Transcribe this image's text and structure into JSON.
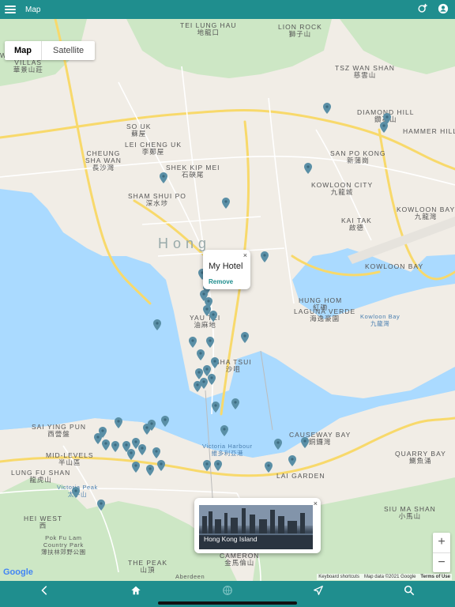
{
  "app": {
    "title": "Map"
  },
  "map_type": {
    "map_label": "Map",
    "satellite_label": "Satellite"
  },
  "popup_hotel": {
    "title": "My Hotel",
    "remove_label": "Remove",
    "close": "×"
  },
  "popup_place": {
    "caption": "Hong Kong Island",
    "close": "×"
  },
  "zoom": {
    "in": "+",
    "out": "−"
  },
  "google_logo": "Google",
  "attribution": {
    "shortcuts": "Keyboard shortcuts",
    "data": "Map data ©2021 Google",
    "terms": "Terms of Use"
  },
  "labels": [
    {
      "id": "tiu-keng",
      "text": "TEI LUNG HAU\n地龍口"
    },
    {
      "id": "lion-rock",
      "text": "LION ROCK\n獅子山"
    },
    {
      "id": "wonderland",
      "text": "WONDERLAND\nVILLAS\n華景山莊"
    },
    {
      "id": "tsz-wan-shan",
      "text": "TSZ WAN SHAN\n慈雲山"
    },
    {
      "id": "diamond-hill",
      "text": "DIAMOND HILL\n鑽石山"
    },
    {
      "id": "su-uk",
      "text": "SO UK\n蘇屋"
    },
    {
      "id": "lei-cheng-uk",
      "text": "LEI CHENG UK\n李鄭屋"
    },
    {
      "id": "hammer-hill",
      "text": "HAMMER HILL"
    },
    {
      "id": "cheung-sha-wan",
      "text": "CHEUNG\nSHA WAN\n長沙灣"
    },
    {
      "id": "shek-kip-mei",
      "text": "SHEK KIP MEI\n石硤尾"
    },
    {
      "id": "san-po-kong",
      "text": "SAN PO KONG\n新蒲崗"
    },
    {
      "id": "sham-shui-po",
      "text": "SHAM SHUI PO\n深水埗"
    },
    {
      "id": "kowloon-city",
      "text": "KOWLOON CITY\n九龍城"
    },
    {
      "id": "kowloon-bay",
      "text": "KOWLOON BAY\n九龍灣"
    },
    {
      "id": "kai-tak",
      "text": "KAI TAK\n啟德"
    },
    {
      "id": "hong",
      "text": "Hong"
    },
    {
      "id": "yau-tei",
      "text": "YAU TEI\n油麻地"
    },
    {
      "id": "hung-hom",
      "text": "HUNG HOM\n紅磡"
    },
    {
      "id": "laguna",
      "text": "LAGUNA VERDE\n海逸豪園"
    },
    {
      "id": "kowloon-bay-water",
      "text": "Kowloon Bay\n九龍灣"
    },
    {
      "id": "tsim-sha-tsui",
      "text": "SHA TSUI\n沙咀"
    },
    {
      "id": "kowloon-bay-2",
      "text": "KOWLOON BAY"
    },
    {
      "id": "sai-ying-pun",
      "text": "SAI YING PUN\n西營盤"
    },
    {
      "id": "victoria-harbour",
      "text": "Victoria Harbour\n維多利亞港"
    },
    {
      "id": "causeway-bay",
      "text": "CAUSEWAY BAY\n銅鑼灣"
    },
    {
      "id": "quarry-bay",
      "text": "QUARRY BAY\n鰂魚涌"
    },
    {
      "id": "mid-levels",
      "text": "MID-LEVELS\n半山區"
    },
    {
      "id": "lung-fu-shan",
      "text": "LUNG FU SHAN\n龍虎山"
    },
    {
      "id": "victoria-peak",
      "text": "Victoria Peak\n太平山"
    },
    {
      "id": "hei-west",
      "text": "HEI WEST\n西"
    },
    {
      "id": "pok-fu-lam",
      "text": "Pok Fu Lam\nCountry Park\n薄扶林郊野公園"
    },
    {
      "id": "the-peak",
      "text": "THE PEAK\n山頂"
    },
    {
      "id": "mount-cameron",
      "text": "MOUNT\nCAMERON\n金馬倫山"
    },
    {
      "id": "siu-ma-shan",
      "text": "SIU MA SHAN\n小馬山"
    },
    {
      "id": "lai-garden",
      "text": "LAI GARDEN"
    },
    {
      "id": "aberdeen",
      "text": "Aberdeen"
    },
    {
      "id": "country-park",
      "text": "Country Park"
    }
  ],
  "pins": 48
}
